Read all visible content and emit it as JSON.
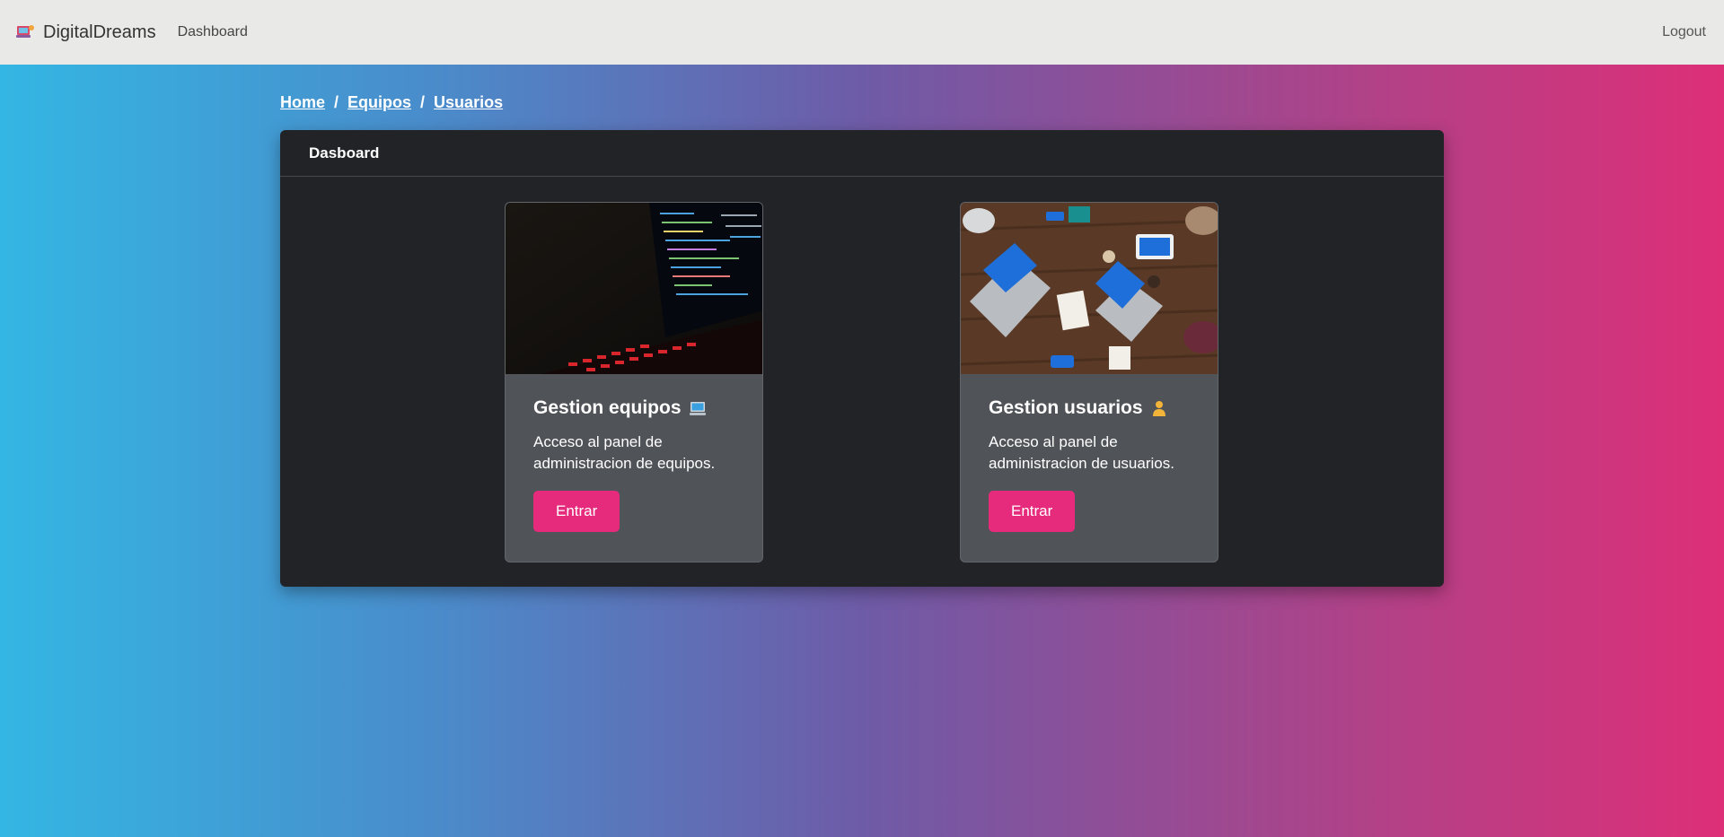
{
  "navbar": {
    "brand": "DigitalDreams",
    "dashboard_link": "Dashboard",
    "logout": "Logout"
  },
  "breadcrumb": {
    "items": [
      "Home",
      "Equipos",
      "Usuarios"
    ],
    "separator": "/"
  },
  "panel": {
    "title": "Dasboard"
  },
  "cards": [
    {
      "title": "Gestion equipos",
      "icon": "computer-icon",
      "text": "Acceso al panel de administracion de equipos.",
      "button": "Entrar"
    },
    {
      "title": "Gestion usuarios",
      "icon": "person-icon",
      "text": "Acceso al panel de administracion de usuarios.",
      "button": "Entrar"
    }
  ],
  "colors": {
    "accent": "#e62b7d",
    "panel_bg": "#212327",
    "card_bg": "#505357",
    "navbar_bg": "#e9e9e8"
  }
}
